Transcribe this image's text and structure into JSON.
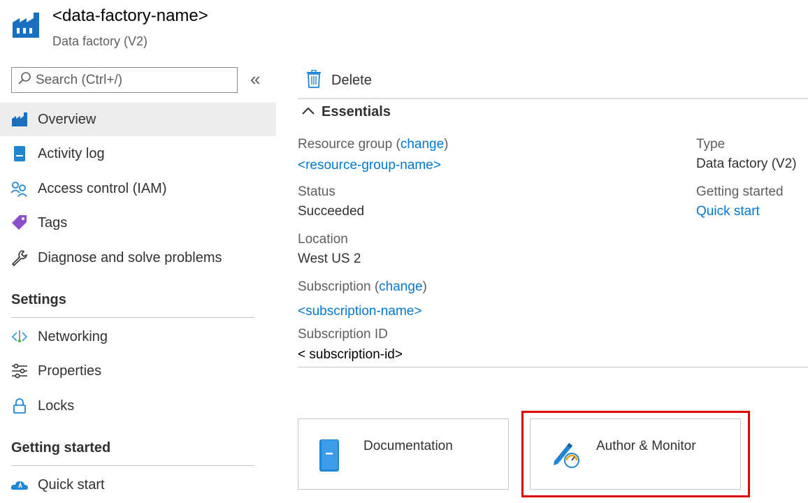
{
  "header": {
    "title": "<data-factory-name>",
    "subtitle": "Data factory (V2)",
    "icon": "data-factory-icon"
  },
  "search": {
    "placeholder": "Search (Ctrl+/)",
    "collapse_glyph": "«"
  },
  "sidebar": {
    "items": [
      {
        "label": "Overview",
        "icon": "data-factory-icon",
        "active": true
      },
      {
        "label": "Activity log",
        "icon": "activity-log-icon"
      },
      {
        "label": "Access control (IAM)",
        "icon": "people-icon"
      },
      {
        "label": "Tags",
        "icon": "tag-icon"
      },
      {
        "label": "Diagnose and solve problems",
        "icon": "wrench-icon"
      }
    ],
    "sections": [
      {
        "title": "Settings",
        "items": [
          {
            "label": "Networking",
            "icon": "networking-icon"
          },
          {
            "label": "Properties",
            "icon": "properties-icon"
          },
          {
            "label": "Locks",
            "icon": "lock-icon"
          }
        ]
      },
      {
        "title": "Getting started",
        "items": [
          {
            "label": "Quick start",
            "icon": "quick-start-icon"
          }
        ]
      }
    ]
  },
  "toolbar": {
    "delete_label": "Delete"
  },
  "essentials": {
    "title": "Essentials",
    "resource_group_label": "Resource group",
    "change_label": "change",
    "resource_group_value": "<resource-group-name>",
    "status_label": "Status",
    "status_value": "Succeeded",
    "location_label": "Location",
    "location_value": "West US 2",
    "subscription_label": "Subscription",
    "subscription_value": "<subscription-name>",
    "subscription_id_label": "Subscription ID",
    "subscription_id_value": "< subscription-id>",
    "type_label": "Type",
    "type_value": "Data factory (V2)",
    "getting_started_label": "Getting started",
    "getting_started_value": "Quick start"
  },
  "cards": {
    "documentation": "Documentation",
    "author_monitor": "Author & Monitor"
  },
  "colors": {
    "link": "#0078d4",
    "highlight": "#e00000",
    "active_nav": "#ededed"
  }
}
